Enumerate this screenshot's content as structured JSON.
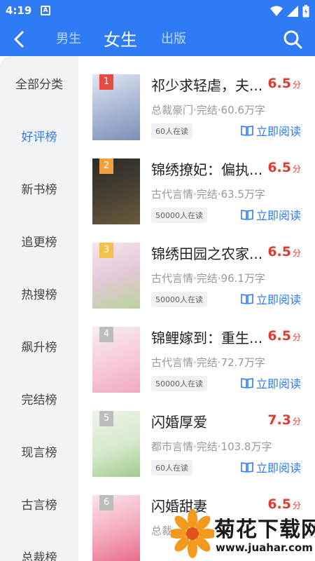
{
  "status_bar": {
    "time": "4:19",
    "app_badge": "A"
  },
  "header": {
    "tabs": [
      {
        "label": "男生",
        "active": false
      },
      {
        "label": "女生",
        "active": true
      },
      {
        "label": "出版",
        "active": false
      }
    ]
  },
  "sidebar": {
    "items": [
      {
        "label": "全部分类",
        "active": false
      },
      {
        "label": "好评榜",
        "active": true
      },
      {
        "label": "新书榜",
        "active": false
      },
      {
        "label": "追更榜",
        "active": false
      },
      {
        "label": "热搜榜",
        "active": false
      },
      {
        "label": "飙升榜",
        "active": false
      },
      {
        "label": "完结榜",
        "active": false
      },
      {
        "label": "现言榜",
        "active": false
      },
      {
        "label": "古言榜",
        "active": false
      },
      {
        "label": "总裁榜",
        "active": false
      }
    ]
  },
  "books": [
    {
      "rank": "1",
      "title": "祁少求轻虐，夫...",
      "score": "6.5",
      "unit": "分",
      "meta": "总裁豪门·完结·60.6万字",
      "readers": "60人在读",
      "read_label": "立即阅读",
      "cover_colors": [
        "#dfe6f2",
        "#7a8fb8"
      ],
      "rank_color": "#e84a3f"
    },
    {
      "rank": "2",
      "title": "锦绣撩妃：偏执...",
      "score": "6.5",
      "unit": "分",
      "meta": "古代言情·完结·63.5万字",
      "readers": "50000人在读",
      "read_label": "立即阅读",
      "cover_colors": [
        "#2a2a28",
        "#6b5b3e"
      ],
      "rank_color": "#f0a23a"
    },
    {
      "rank": "3",
      "title": "锦绣田园之农家...",
      "score": "6.5",
      "unit": "分",
      "meta": "古代言情·完结·96.1万字",
      "readers": "50000人在读",
      "read_label": "立即阅读",
      "cover_colors": [
        "#f4e6ee",
        "#b9d39a"
      ],
      "rank_color": "#f4c24a"
    },
    {
      "rank": "4",
      "title": "锦鲤嫁到：重生...",
      "score": "6.5",
      "unit": "分",
      "meta": "古代言情·完结·72.7万字",
      "readers": "50000人在读",
      "read_label": "立即阅读",
      "cover_colors": [
        "#f6eef0",
        "#f1a9c0"
      ],
      "rank_color": "#bdbdbd"
    },
    {
      "rank": "5",
      "title": "闪婚厚爱",
      "score": "7.3",
      "unit": "分",
      "meta": "都市言情·完结·103.8万字",
      "readers": "60人在读",
      "read_label": "立即阅读",
      "cover_colors": [
        "#eef4ea",
        "#9fcc8a"
      ],
      "rank_color": "#bdbdbd"
    },
    {
      "rank": "6",
      "title": "闪婚甜妻",
      "score": "6.5",
      "unit": "分",
      "meta": "总裁",
      "readers": "",
      "read_label": "",
      "cover_colors": [
        "#fbe4ea",
        "#e86c8d"
      ],
      "rank_color": "#bdbdbd"
    }
  ],
  "watermark": {
    "text": "菊花下载网",
    "url": "www.juahar.com"
  }
}
